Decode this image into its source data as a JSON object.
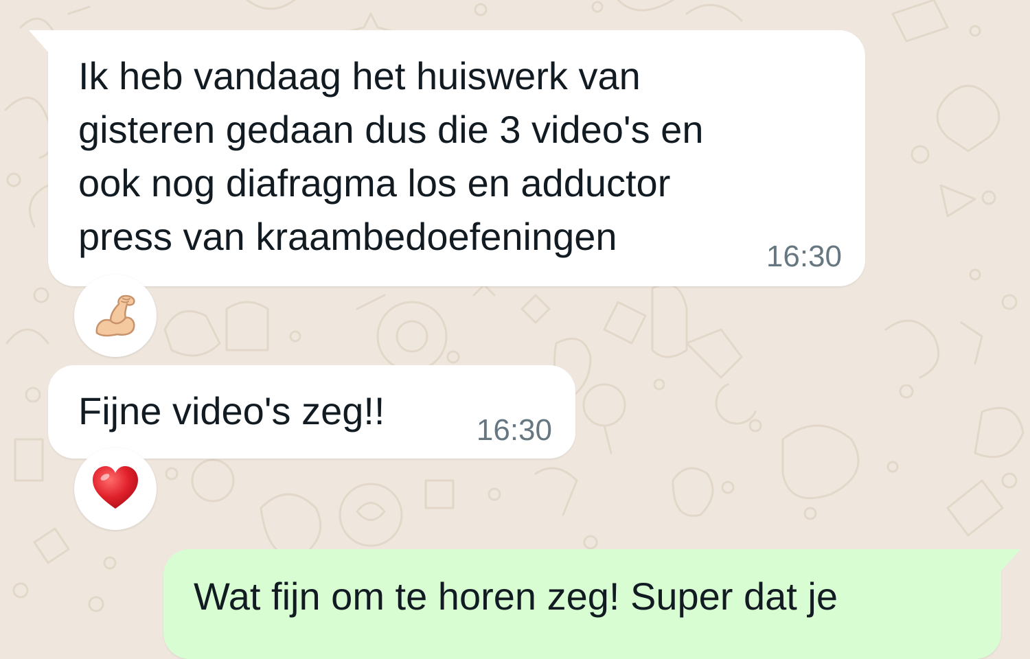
{
  "messages": [
    {
      "direction": "incoming",
      "text": "Ik heb vandaag het huiswerk van\ngisteren gedaan dus die 3 video's en\nook nog diafragma los en adductor\npress van kraambedoefeningen",
      "time": "16:30",
      "reaction": "flexed-biceps"
    },
    {
      "direction": "incoming",
      "text": "Fijne video's zeg!!",
      "time": "16:30",
      "reaction": "red-heart"
    },
    {
      "direction": "outgoing",
      "text": "Wat fijn om te horen zeg! Super dat je"
    }
  ],
  "colors": {
    "wallpaper": "#efe7dd",
    "incoming_bubble": "#ffffff",
    "outgoing_bubble": "#d9fdd3",
    "timestamp": "#667781",
    "heart": "#e0202b"
  }
}
